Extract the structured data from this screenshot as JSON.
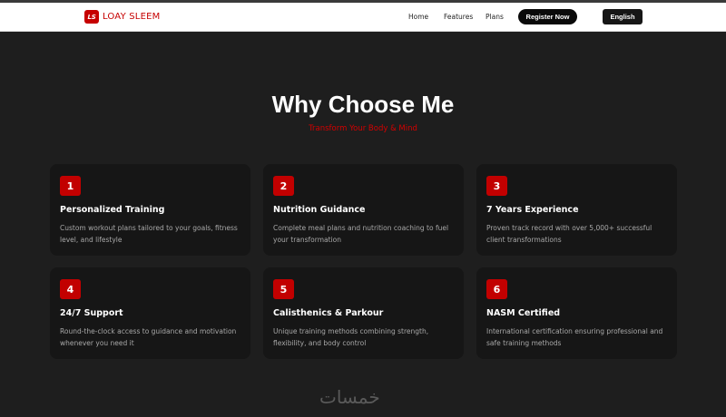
{
  "brand": {
    "badge": "LS",
    "name": "LOAY SLEEM"
  },
  "nav": {
    "links": [
      "Home",
      "Features",
      "Plans"
    ],
    "register_label": "Register Now",
    "language_label": "English"
  },
  "section": {
    "title": "Why Choose Me",
    "subtitle": "Transform Your Body & Mind"
  },
  "features": [
    {
      "number": "1",
      "title": "Personalized Training",
      "description": "Custom workout plans tailored to your goals, fitness level, and lifestyle"
    },
    {
      "number": "2",
      "title": "Nutrition Guidance",
      "description": "Complete meal plans and nutrition coaching to fuel your transformation"
    },
    {
      "number": "3",
      "title": "7 Years Experience",
      "description": "Proven track record with over 5,000+ successful client transformations"
    },
    {
      "number": "4",
      "title": "24/7 Support",
      "description": "Round-the-clock access to guidance and motivation whenever you need it"
    },
    {
      "number": "5",
      "title": "Calisthenics & Parkour",
      "description": "Unique training methods combining strength, flexibility, and body control"
    },
    {
      "number": "6",
      "title": "NASM Certified",
      "description": "International certification ensuring professional and safe training methods"
    }
  ],
  "watermark": "خمسات",
  "colors": {
    "accent": "#c60000",
    "background": "#1e1e1e",
    "card": "#161616"
  }
}
